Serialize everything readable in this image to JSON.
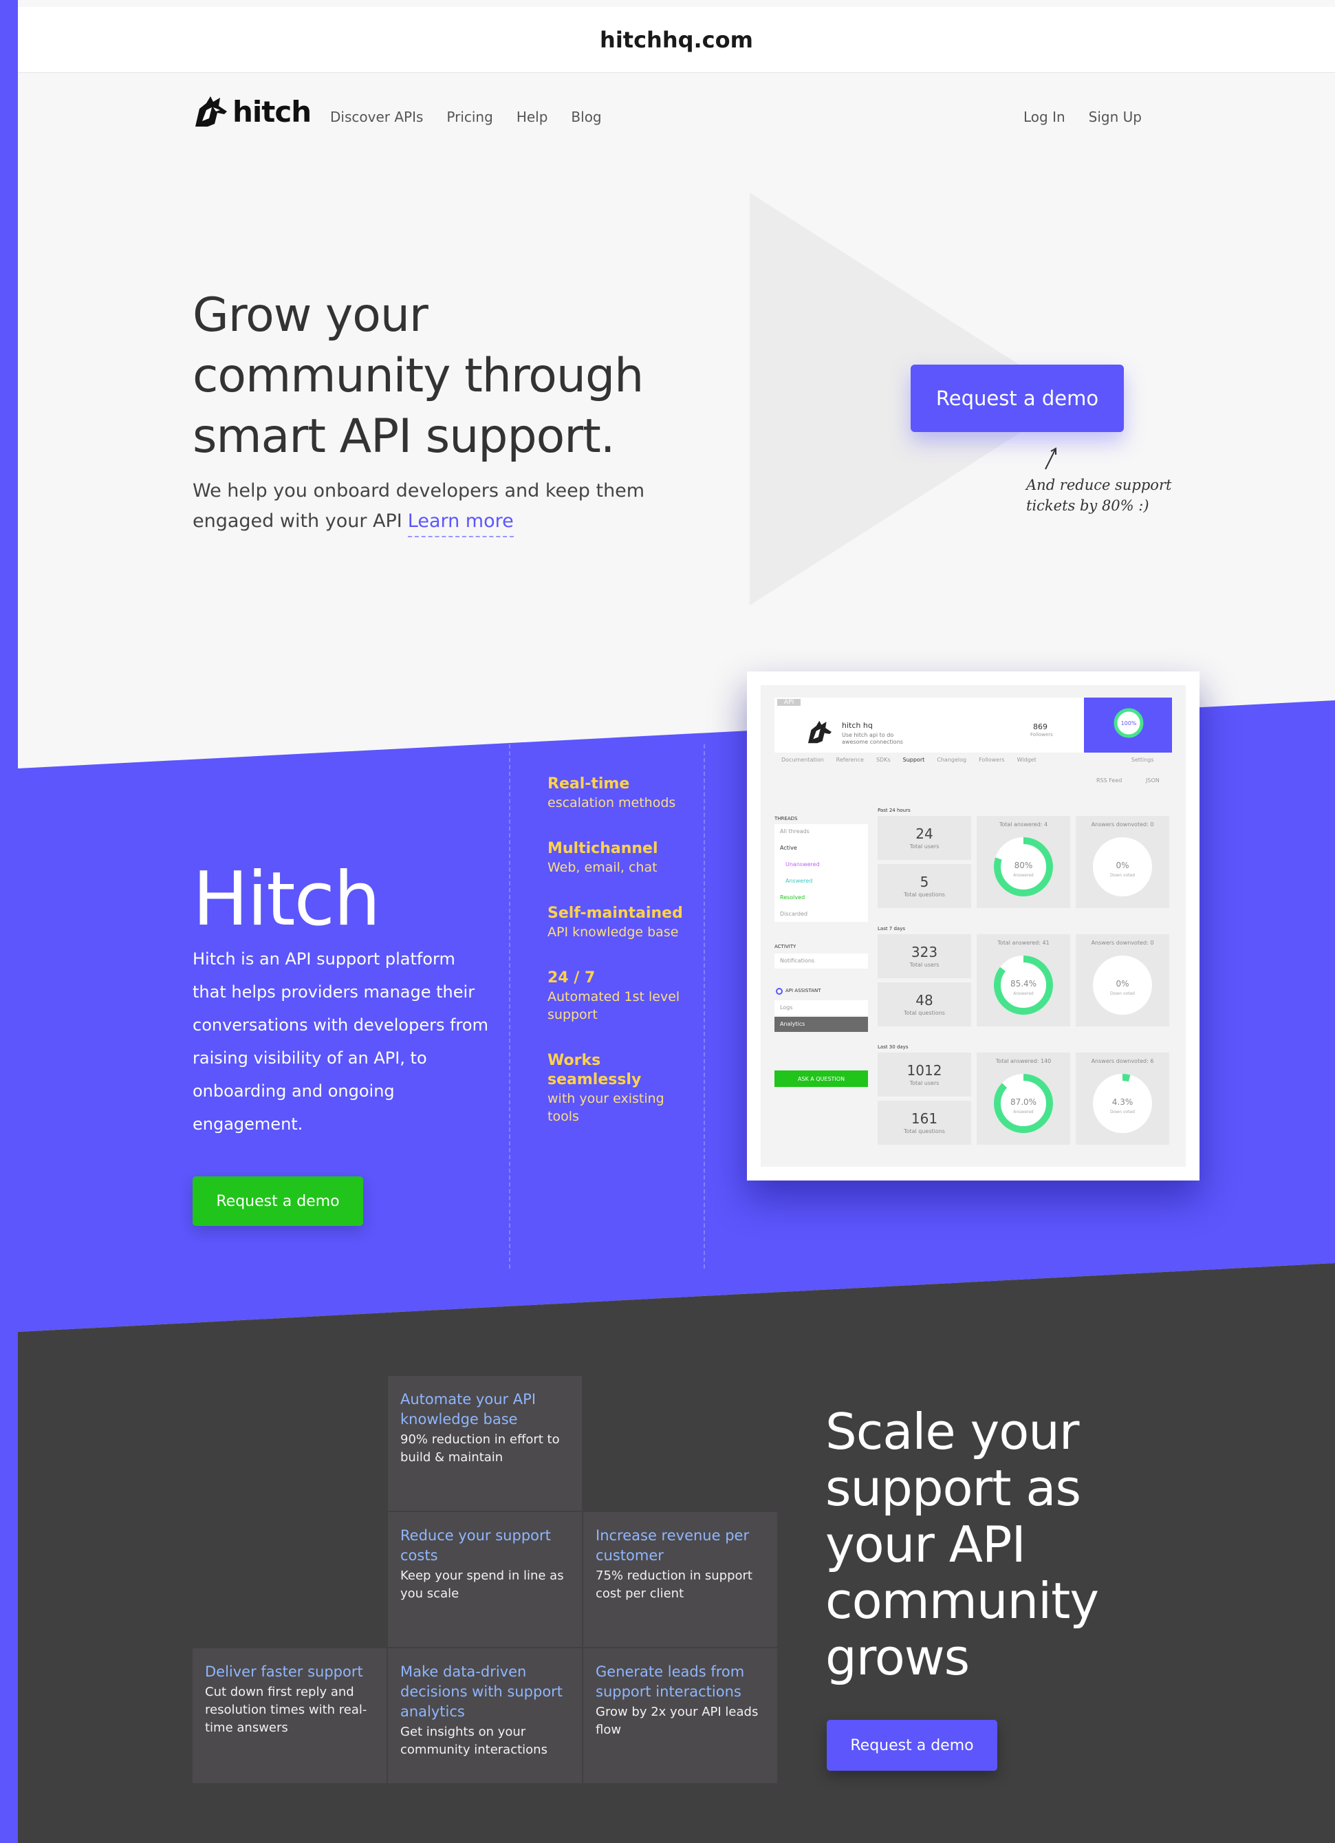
{
  "browser": {
    "url": "hitchhq.com"
  },
  "nav": {
    "logo_text": "hitch",
    "left_links": [
      "Discover APIs",
      "Pricing",
      "Help",
      "Blog"
    ],
    "right_links": [
      "Log In",
      "Sign Up"
    ]
  },
  "hero": {
    "title": "Grow your community through smart API support.",
    "subtitle": "We help you onboard developers and keep them engaged with your API",
    "learn_more": "Learn more",
    "cta": "Request a demo",
    "note": "And reduce support tickets by 80% :)"
  },
  "intro": {
    "title": "Hitch",
    "description": "Hitch is an API support platform that helps providers manage their conversations with developers from raising visibility of an API, to onboarding and ongoing engagement.",
    "cta": "Request a demo",
    "features": [
      {
        "title": "Real-time",
        "desc": "escalation methods"
      },
      {
        "title": "Multichannel",
        "desc": "Web, email, chat"
      },
      {
        "title": "Self-maintained",
        "desc": "API knowledge base"
      },
      {
        "title": "24 / 7",
        "desc": "Automated 1st level support"
      },
      {
        "title": "Works seamlessly",
        "desc": "with your existing tools"
      }
    ]
  },
  "dashboard": {
    "tag": "API",
    "name": "hitch hq",
    "tagline": "Use hitch api to do awesome connections",
    "followers_count": "869",
    "followers_label": "Followers",
    "ring_value": "100%",
    "tabs": [
      "Documentation",
      "Reference",
      "SDKs",
      "Support",
      "Changelog",
      "Followers",
      "Widget",
      "Settings"
    ],
    "feed_links": [
      "RSS Feed",
      "JSON"
    ],
    "threads_label": "THREADS",
    "threads": [
      "All threads",
      "Active",
      "Unanswered",
      "Answered",
      "Resolved",
      "Discarded"
    ],
    "activity_label": "ACTIVITY",
    "activity": [
      "Notifications"
    ],
    "assistant_label": "API ASSISTANT",
    "assistant": [
      "Logs",
      "Analytics"
    ],
    "ask_button": "ASK A QUESTION",
    "periods": [
      {
        "label": "Past 24 hours",
        "users": "24",
        "questions": "5",
        "answered_label": "Total answered: 4",
        "answered_pct": "80%",
        "downvoted_label": "Answers downvoted: 0",
        "downvoted_pct": "0%"
      },
      {
        "label": "Last 7 days",
        "users": "323",
        "questions": "48",
        "answered_label": "Total answered: 41",
        "answered_pct": "85.4%",
        "downvoted_label": "Answers downvoted: 0",
        "downvoted_pct": "0%"
      },
      {
        "label": "Last 30 days",
        "users": "1012",
        "questions": "161",
        "answered_label": "Total answered: 140",
        "answered_pct": "87.0%",
        "downvoted_label": "Answers downvoted: 6",
        "downvoted_pct": "4.3%"
      }
    ],
    "answered_fractions": [
      0.8,
      0.854,
      0.87
    ],
    "downvoted_fractions": [
      0,
      0,
      0.043
    ],
    "users_label": "Total users",
    "questions_label": "Total questions",
    "answered_ring_label": "Answered",
    "downvoted_ring_label": "Down voted"
  },
  "scale": {
    "title": "Scale your support as your API community grows",
    "cta": "Request a demo",
    "tiles": [
      {
        "title": "Automate your API knowledge base",
        "desc": "90% reduction in effort to build & maintain"
      },
      {
        "title": "Reduce your support costs",
        "desc": "Keep your spend in line as you scale"
      },
      {
        "title": "Increase revenue per customer",
        "desc": "75% reduction in support cost per client"
      },
      {
        "title": "Deliver faster support",
        "desc": "Cut down first reply and resolution times with real-time answers"
      },
      {
        "title": "Make data-driven decisions with support analytics",
        "desc": "Get insights on your community interactions"
      },
      {
        "title": "Generate leads from support interactions",
        "desc": "Grow by 2x your API leads flow"
      }
    ]
  },
  "colors": {
    "brand": "#5c56fc",
    "green": "#21c41a",
    "dark": "#414041",
    "feature": "#ffd24a",
    "tile_title": "#8fb6ff"
  }
}
